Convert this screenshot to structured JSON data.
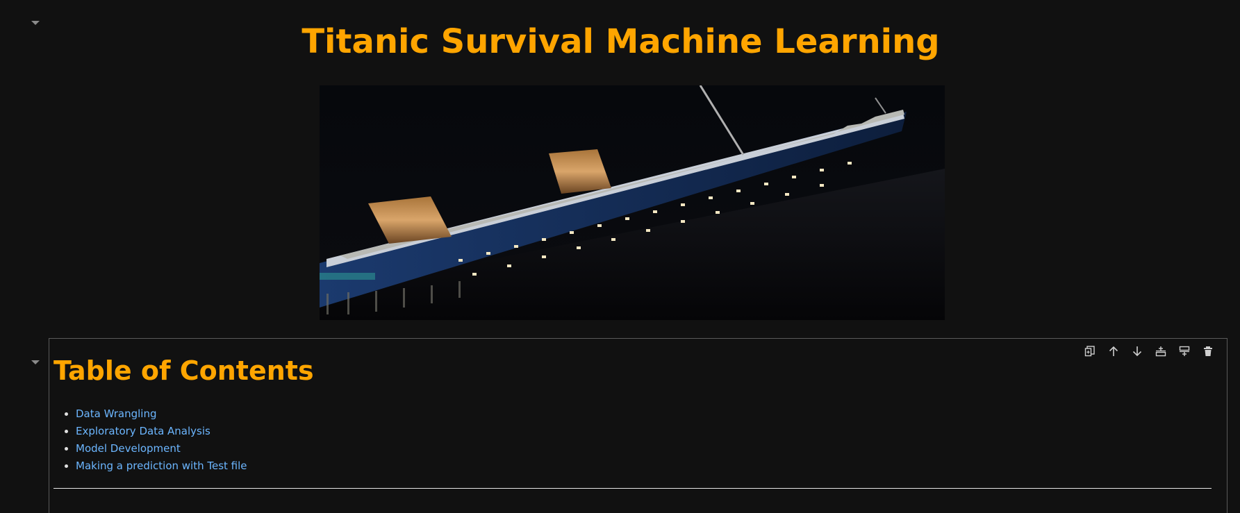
{
  "notebook": {
    "title": "Titanic Survival Machine Learning",
    "toc": {
      "heading": "Table of Contents",
      "items": [
        {
          "label": "Data Wrangling"
        },
        {
          "label": "Exploratory Data Analysis"
        },
        {
          "label": "Model Development"
        },
        {
          "label": "Making a prediction with Test file"
        }
      ]
    },
    "cell_toolbar": {
      "icons": [
        "duplicate-icon",
        "move-up-icon",
        "move-down-icon",
        "insert-below-icon",
        "insert-above-icon",
        "delete-icon"
      ]
    }
  },
  "colors": {
    "background": "#111111",
    "heading": "#ffa500",
    "link": "#6cb6ff",
    "toolbar_icon": "#cfcfcf",
    "cell_border": "#5a5a5a"
  }
}
